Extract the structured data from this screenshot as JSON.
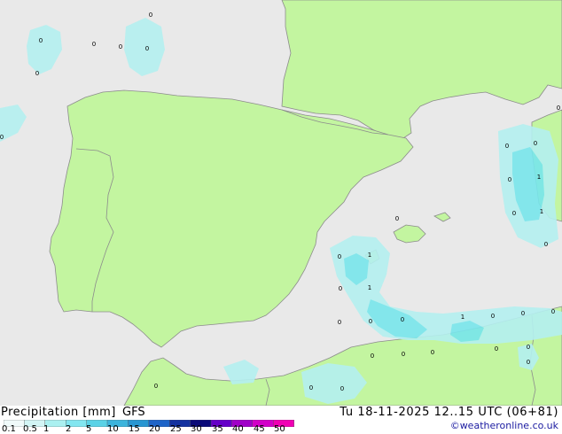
{
  "map": {
    "colors": {
      "sea": "#e9e9e9",
      "land": "#c3f5a0",
      "coast": "#8c8c8c",
      "border": "#8c8c8c",
      "precip_light": "#b4f0f0",
      "precip_medium": "#78e6ec",
      "precip_heavy": "#46cce0"
    },
    "markers": [
      "0",
      "0",
      "0",
      "0",
      "0",
      "0",
      "0",
      "0",
      "0",
      "0",
      "1",
      "0",
      "0",
      "0",
      "1",
      "1",
      "0",
      "0",
      "0",
      "1",
      "0",
      "0",
      "0",
      "1",
      "0",
      "0",
      "0",
      "0",
      "0",
      "0",
      "0",
      "0",
      "0",
      "0",
      "0",
      "0"
    ]
  },
  "footer": {
    "title": "Precipitation [mm]",
    "model": "GFS",
    "datetime": "Tu 18-11-2025 12..15 UTC (06+81)",
    "credit": "©weatheronline.co.uk",
    "legend": {
      "ticks": [
        "0.1",
        "0.5",
        "1",
        "2",
        "5",
        "10",
        "15",
        "20",
        "25",
        "30",
        "35",
        "40",
        "45",
        "50"
      ],
      "colors": [
        "#f0fafa",
        "#d2f5f5",
        "#aaf0f0",
        "#82e6f0",
        "#5ad2e6",
        "#3cb4dc",
        "#2896d2",
        "#1e64c8",
        "#1432a0",
        "#0a0a78",
        "#6400c8",
        "#a000c8",
        "#d200c8",
        "#f000b4",
        "#ff50e6"
      ]
    }
  }
}
